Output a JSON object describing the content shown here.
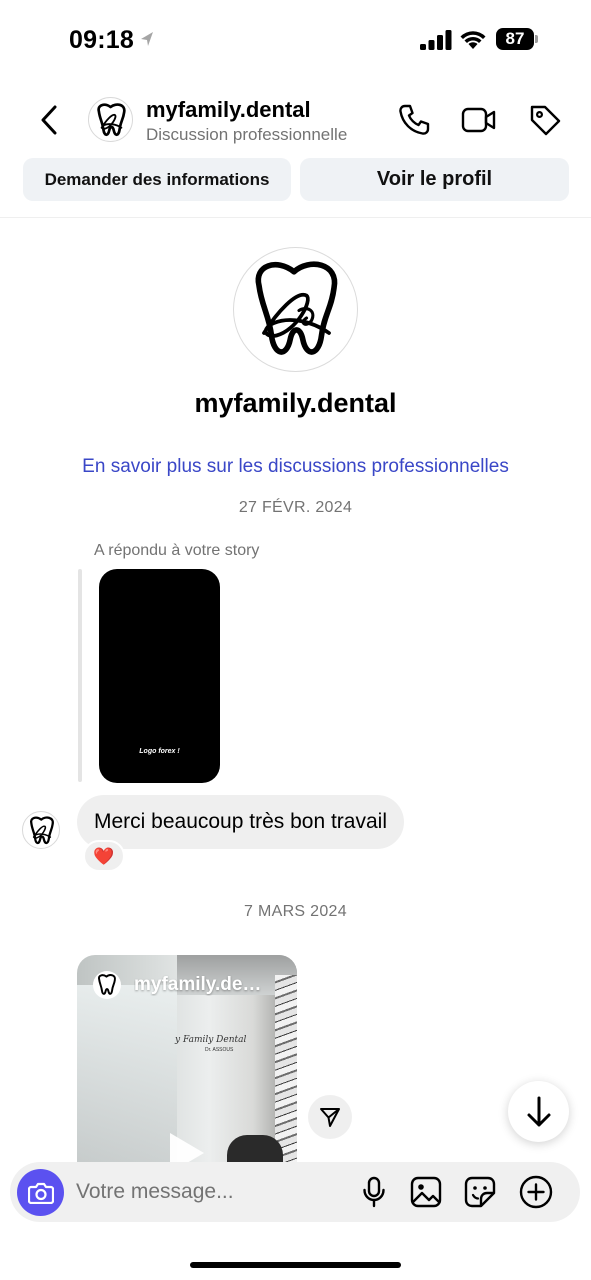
{
  "status_bar": {
    "time": "09:18",
    "battery": "87"
  },
  "header": {
    "name": "myfamily.dental",
    "subtitle": "Discussion professionnelle",
    "actions": {
      "request_info": "Demander des informations",
      "view_profile": "Voir le profil"
    }
  },
  "profile": {
    "name": "myfamily.dental",
    "learn_more": "En savoir plus sur les discussions professionnelles"
  },
  "thread": {
    "date_1": "27 FÉVR. 2024",
    "story_reply_label": "A répondu à votre story",
    "story_caption": "Logo forex !",
    "message_1": "Merci beaucoup très bon travail",
    "reaction": "❤️",
    "date_2": "7 MARS 2024",
    "shared_post": {
      "account": "myfamily.dental",
      "sign_text": "y Family Dental",
      "sign_sub": "Dr. ASSOUS"
    }
  },
  "composer": {
    "placeholder": "Votre message..."
  },
  "icons": {
    "back": "chevron-left-icon",
    "phone": "phone-icon",
    "video": "video-camera-icon",
    "tag": "tag-icon",
    "camera": "camera-icon",
    "mic": "microphone-icon",
    "gallery": "image-icon",
    "sticker": "sticker-icon",
    "plus": "plus-circle-icon",
    "share": "paper-plane-icon",
    "scroll_down": "arrow-down-icon"
  },
  "colors": {
    "accent": "#5b51f0",
    "link": "#3a47c7",
    "bubble": "#efefef",
    "pill": "#eff2f5"
  }
}
